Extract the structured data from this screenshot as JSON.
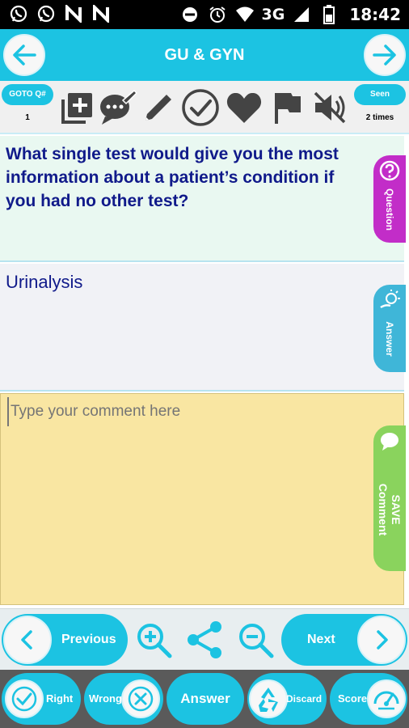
{
  "status_bar": {
    "network": "3G",
    "time": "18:42",
    "icons": [
      "whatsapp-icon",
      "whatsapp-icon",
      "n-app-icon",
      "n-app-icon",
      "dnd-icon",
      "alarm-icon",
      "wifi-icon",
      "signal-icon",
      "battery-icon"
    ]
  },
  "header": {
    "title": "GU & GYN",
    "accent_color": "#1cc3e2"
  },
  "toolbar": {
    "goto_label": "GOTO Q#",
    "goto_value": "1",
    "seen_label": "Seen",
    "seen_value": "2 times",
    "tools": [
      "add-note-icon",
      "comment-bubble-icon",
      "edit-pencil-icon",
      "check-circle-icon",
      "heart-icon",
      "flag-icon",
      "mute-icon"
    ]
  },
  "question": {
    "text": "What single test would give you the most information about a patient’s condition if you had no other test?",
    "tab_label": "Question",
    "tab_color": "#c22dc8"
  },
  "answer": {
    "text": "Urinalysis",
    "tab_label": "Answer",
    "tab_color": "#3fb6d8"
  },
  "comment": {
    "placeholder": "Type your comment here",
    "tab_label_line1": "SAVE",
    "tab_label_line2": "Comment",
    "tab_color": "#8ad35d"
  },
  "nav": {
    "previous_label": "Previous",
    "next_label": "Next"
  },
  "actions": {
    "right_label": "Right",
    "wrong_label": "Wrong",
    "answer_label": "Answer",
    "discard_label": "Discard",
    "score_label": "Score"
  }
}
